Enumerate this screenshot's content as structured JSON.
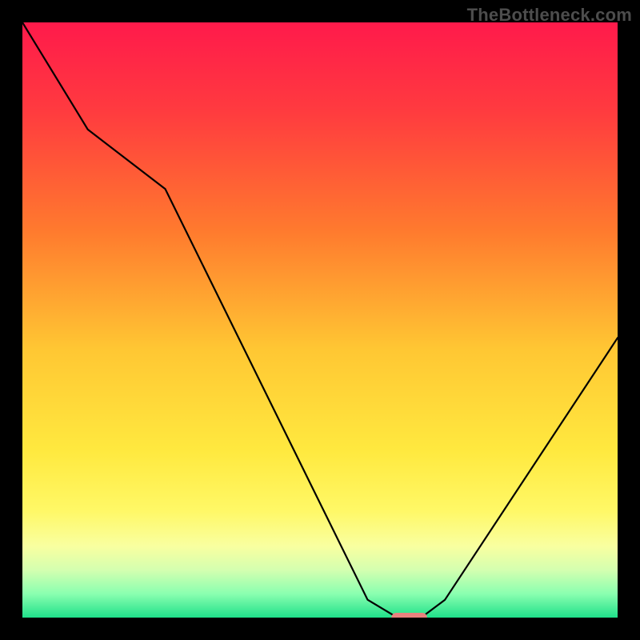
{
  "watermark": "TheBottleneck.com",
  "chart_data": {
    "type": "line",
    "title": "",
    "xlabel": "",
    "ylabel": "",
    "xlim": [
      0,
      100
    ],
    "ylim": [
      0,
      100
    ],
    "x": [
      0,
      11,
      24,
      58,
      63,
      67,
      71,
      100
    ],
    "values": [
      100,
      82,
      72,
      3,
      0,
      0,
      3,
      47
    ],
    "optimum_marker": {
      "x": 65,
      "y": 0,
      "width": 6
    },
    "gradient_stops": [
      {
        "offset": 0.0,
        "color": "#ff1a4b"
      },
      {
        "offset": 0.15,
        "color": "#ff3b3f"
      },
      {
        "offset": 0.35,
        "color": "#ff7a2e"
      },
      {
        "offset": 0.55,
        "color": "#ffc733"
      },
      {
        "offset": 0.72,
        "color": "#ffe93f"
      },
      {
        "offset": 0.82,
        "color": "#fff866"
      },
      {
        "offset": 0.88,
        "color": "#f9ffa0"
      },
      {
        "offset": 0.92,
        "color": "#d4ffb0"
      },
      {
        "offset": 0.96,
        "color": "#8affb0"
      },
      {
        "offset": 1.0,
        "color": "#1fe08a"
      }
    ],
    "marker_color": "#e9827f"
  }
}
